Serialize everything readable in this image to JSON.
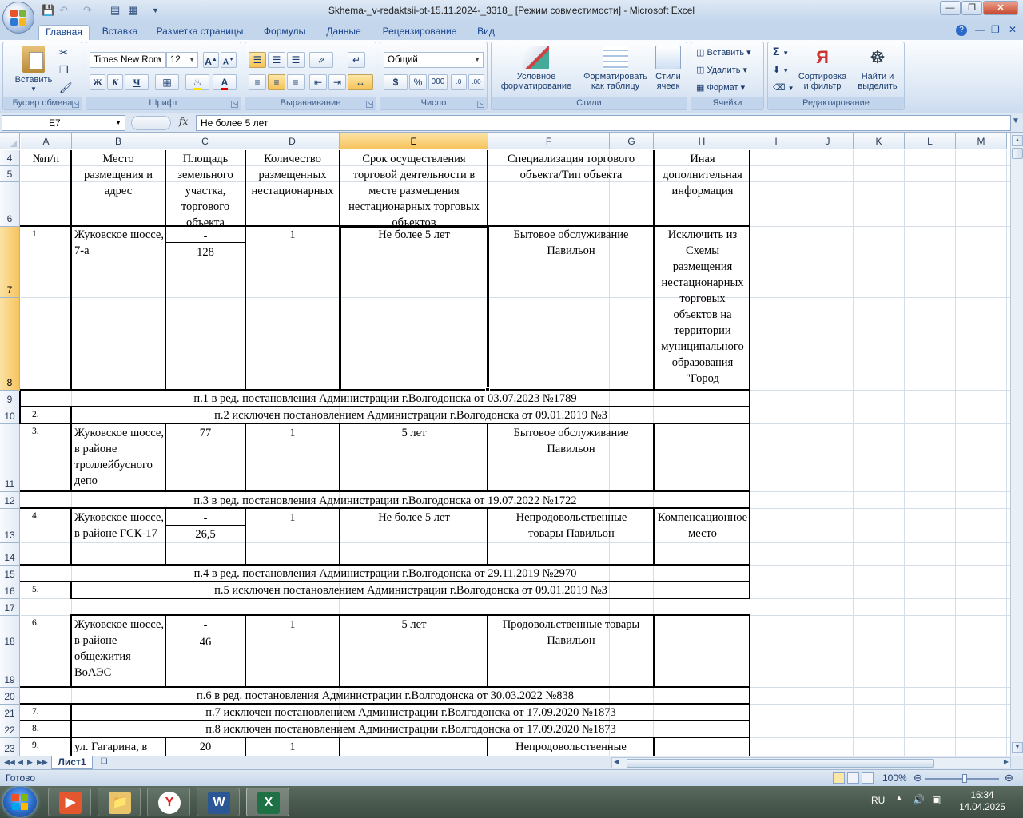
{
  "window": {
    "title": "Skhema-_v-redaktsii-ot-15.11.2024-_3318_  [Режим совместимости] - Microsoft Excel"
  },
  "ribbon": {
    "tabs": [
      "Главная",
      "Вставка",
      "Разметка страницы",
      "Формулы",
      "Данные",
      "Рецензирование",
      "Вид"
    ],
    "active_tab": "Главная",
    "clipboard": {
      "paste": "Вставить",
      "label": "Буфер обмена"
    },
    "font": {
      "name": "Times New Rom",
      "size": "12",
      "bold": "Ж",
      "italic": "К",
      "underline": "Ч",
      "label": "Шрифт"
    },
    "alignment": {
      "label": "Выравнивание"
    },
    "number": {
      "format": "Общий",
      "currency": "$",
      "percent": "%",
      "thousands": "000",
      "label": "Число"
    },
    "styles": {
      "conditional": "Условное форматирование",
      "as_table": "Форматировать как таблицу",
      "cell_styles": "Стили ячеек",
      "label": "Стили"
    },
    "cells": {
      "insert": "Вставить",
      "delete": "Удалить",
      "format": "Формат",
      "label": "Ячейки"
    },
    "editing": {
      "sigma": "Σ",
      "sort": "Сортировка и фильтр",
      "find": "Найти и выделить",
      "label": "Редактирование"
    }
  },
  "formula_bar": {
    "name_box": "E7",
    "fx": "fx",
    "value": "Не более 5 лет"
  },
  "columns": [
    "A",
    "B",
    "C",
    "D",
    "E",
    "F",
    "G",
    "H",
    "I",
    "J",
    "K",
    "L",
    "M"
  ],
  "selected_column": "E",
  "rows": [
    "4",
    "5",
    "6",
    "7",
    "8",
    "9",
    "10",
    "11",
    "12",
    "13",
    "14",
    "15",
    "16",
    "17",
    "18",
    "19",
    "20",
    "21",
    "22",
    "23"
  ],
  "selected_rows": [
    "7",
    "8"
  ],
  "table": {
    "header": {
      "a": "№п/п",
      "b": "Место размещения и адрес",
      "c": "Площадь земельного участка, торгового объекта",
      "d": "Количество размещенных нестационарных объектов",
      "e": "Срок осуществления торговой деятельности в месте размещения нестационарных торговых объектов",
      "f": "Специализация торгового объекта/Тип объекта",
      "h": "Иная дополнительная информация"
    },
    "rec1": {
      "num": "1.",
      "address": "Жуковское шоссе, 7-а",
      "c_top": "-",
      "c_bottom": "128",
      "count": "1",
      "term": "Не более 5 лет",
      "spec": "Бытовое обслуживание Павильон",
      "info": "Исключить из Схемы размещения нестационарных торговых объектов на территории муниципального образования \"Город"
    },
    "note9": "п.1 в ред. постановления Администрации г.Волгодонска от 03.07.2023 №1789",
    "rec2": {
      "num": "2.",
      "note": "п.2 исключен  постановлением Администрации г.Волгодонска от 09.01.2019 №3"
    },
    "rec3": {
      "num": "3.",
      "address": "Жуковское шоссе, в районе троллейбусного депо",
      "area": "77",
      "count": "1",
      "term": "5 лет",
      "spec": "Бытовое обслуживание Павильон"
    },
    "note12": "п.3 в ред. постановления Администрации г.Волгодонска от 19.07.2022 №1722",
    "rec4": {
      "num": "4.",
      "address": "Жуковское шоссе, в районе ГСК-17",
      "c_top": "-",
      "c_bottom": "26,5",
      "count": "1",
      "term": "Не более 5 лет",
      "spec": "Непродовольственные товары Павильон",
      "info": "Компенсационное место"
    },
    "note15": "п.4 в ред. постановления Администрации г.Волгодонска от 29.11.2019 №2970",
    "rec5": {
      "num": "5.",
      "note": "п.5 исключен  постановлением Администрации г.Волгодонска от 09.01.2019 №3"
    },
    "rec6": {
      "num": "6.",
      "address": "Жуковское шоссе, в районе общежития ВоАЭС",
      "c_top": "-",
      "c_bottom": "46",
      "count": "1",
      "term": "5 лет",
      "spec": "Продовольственные товары Павильон"
    },
    "note20": "п.6 в ред. постановления Администрации г.Волгодонска от 30.03.2022 №838",
    "rec7": {
      "num": "7.",
      "note": "п.7 исключен  постановлением Администрации г.Волгодонска от 17.09.2020 №1873"
    },
    "rec8": {
      "num": "8.",
      "note": "п.8 исключен  постановлением Администрации г.Волгодонска от 17.09.2020 №1873"
    },
    "rec9": {
      "num": "9.",
      "address": "ул. Гагарина, в",
      "area": "20",
      "count": "1",
      "spec": "Непродовольственные"
    }
  },
  "sheet_tabs": {
    "active": "Лист1"
  },
  "status": {
    "ready": "Готово",
    "zoom": "100%"
  },
  "taskbar": {
    "lang": "RU",
    "time": "16:34",
    "date": "14.04.2025"
  }
}
